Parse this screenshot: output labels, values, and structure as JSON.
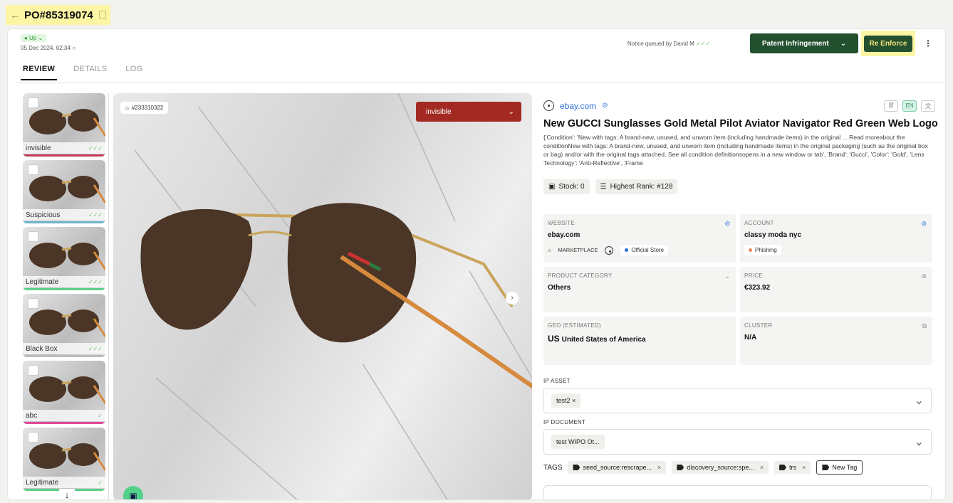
{
  "header": {
    "back": "←",
    "po_number": "PO#85319074"
  },
  "status": {
    "pill": "● Up ⌄",
    "date": "05 Dec 2024, 02:34",
    "clock": "○"
  },
  "notice": {
    "text": "Notice queued by David M",
    "ticks": "✓✓✓"
  },
  "actions": {
    "patent": "Patent Infringement",
    "patent_chev": "⌄",
    "enforce": "Re Enforce",
    "more": "⋮"
  },
  "tabs": [
    "REVIEW",
    "DETAILS",
    "LOG"
  ],
  "thumbnails": [
    {
      "label": "invisible",
      "ticks": "✓✓✓",
      "bar": "#c23b55"
    },
    {
      "label": "Suspicious",
      "ticks": "✓✓✓",
      "bar": "#6fb6c9"
    },
    {
      "label": "Legitimate",
      "ticks": "✓✓✓",
      "bar": "#5ecf89"
    },
    {
      "label": "Black Box",
      "ticks": "✓✓✓",
      "bar": "#bbbbbb"
    },
    {
      "label": "abc",
      "ticks": "✓",
      "bar": "#e14b9a"
    },
    {
      "label": "Legitimate",
      "ticks": "✓",
      "bar": "#5ecf89"
    }
  ],
  "scroll_down": "↓",
  "image": {
    "id": "#233310322",
    "status": "invisible",
    "status_chev": "⌄",
    "next": "›"
  },
  "listing": {
    "site": "ebay.com",
    "lang_doc": "🗎",
    "lang_en": "EN",
    "lang_translate": "文",
    "title": "New GUCCI Sunglasses Gold Metal Pilot Aviator Navigator Red Green Web Logo",
    "description": "{'Condition': 'New with tags: A brand-new, unused, and unworn item (including handmade items) in the original ... Read moreabout the conditionNew with tags: A brand-new, unused, and unworn item (including handmade items) in the original packaging (such as the original box or bag) and/or with the original tags attached. See all condition definitionsopens in a new window or tab', 'Brand': 'Gucci', 'Color': 'Gold', 'Lens Technology': 'Anti-Reflective', 'Frame",
    "stock": "Stock: 0",
    "rank": "Highest Rank: #128"
  },
  "info": {
    "website_label": "WEBSITE",
    "website": "ebay.com",
    "marketplace": "MARKETPLACE",
    "official": "Official Store",
    "account_label": "ACCOUNT",
    "account": "classy moda nyc",
    "phishing": "Phishing",
    "category_label": "PRODUCT CATEGORY",
    "category": "Others",
    "price_label": "PRICE",
    "price": "€323.92",
    "geo_label": "GEO (ESTIMATED)",
    "geo_code": "US",
    "geo": "United States of America",
    "cluster_label": "CLUSTER",
    "cluster": "N/A"
  },
  "ip_asset": {
    "label": "IP ASSET",
    "chip": "test2 ×"
  },
  "ip_document": {
    "label": "IP DOCUMENT",
    "chip": "test WIPO Ot..."
  },
  "tags": {
    "label": "TAGS",
    "items": [
      "seed_source:rescrape...",
      "discovery_source:spe...",
      "trs"
    ],
    "new": "New Tag"
  }
}
